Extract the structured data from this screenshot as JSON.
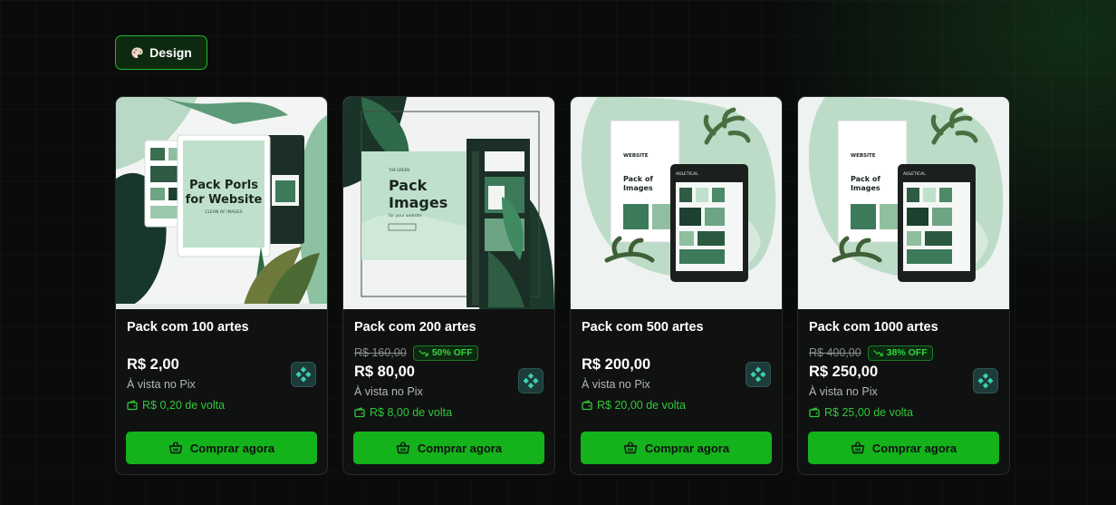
{
  "category": {
    "label": "Design",
    "icon": "palette-icon"
  },
  "colors": {
    "accent": "#14b21b",
    "discount_text": "#35d23f",
    "card_bg": "#101111",
    "page_bg": "#0a0b0b"
  },
  "cards": [
    {
      "title": "Pack com 100 artes",
      "old_price": "",
      "discount": "",
      "price": "R$ 2,00",
      "payment_note": "À vista no Pix",
      "cashback": "R$ 0,20 de volta",
      "button": "Comprar agora",
      "thumb_text": [
        "Pack Porls",
        "for  Website",
        "CLEAN OF IMAGES"
      ]
    },
    {
      "title": "Pack com 200 artes",
      "old_price": "R$ 160,00",
      "discount": "50% OFF",
      "price": "R$ 80,00",
      "payment_note": "À vista no Pix",
      "cashback": "R$ 8,00 de volta",
      "button": "Comprar agora",
      "thumb_text": [
        "THE GREEN",
        "Pack",
        "Images",
        "for your website"
      ]
    },
    {
      "title": "Pack com 500 artes",
      "old_price": "",
      "discount": "",
      "price": "R$ 200,00",
      "payment_note": "À vista no Pix",
      "cashback": "R$ 20,00 de volta",
      "button": "Comprar agora",
      "thumb_text": [
        "WEBSITE",
        "Pack of",
        "Images",
        "AOLETICAL"
      ]
    },
    {
      "title": "Pack com 1000 artes",
      "old_price": "R$ 400,00",
      "discount": "38% OFF",
      "price": "R$ 250,00",
      "payment_note": "À vista no Pix",
      "cashback": "R$ 25,00 de volta",
      "button": "Comprar agora",
      "thumb_text": [
        "WEBSITE",
        "Pack of",
        "Images",
        "AOLETICAL"
      ]
    }
  ]
}
